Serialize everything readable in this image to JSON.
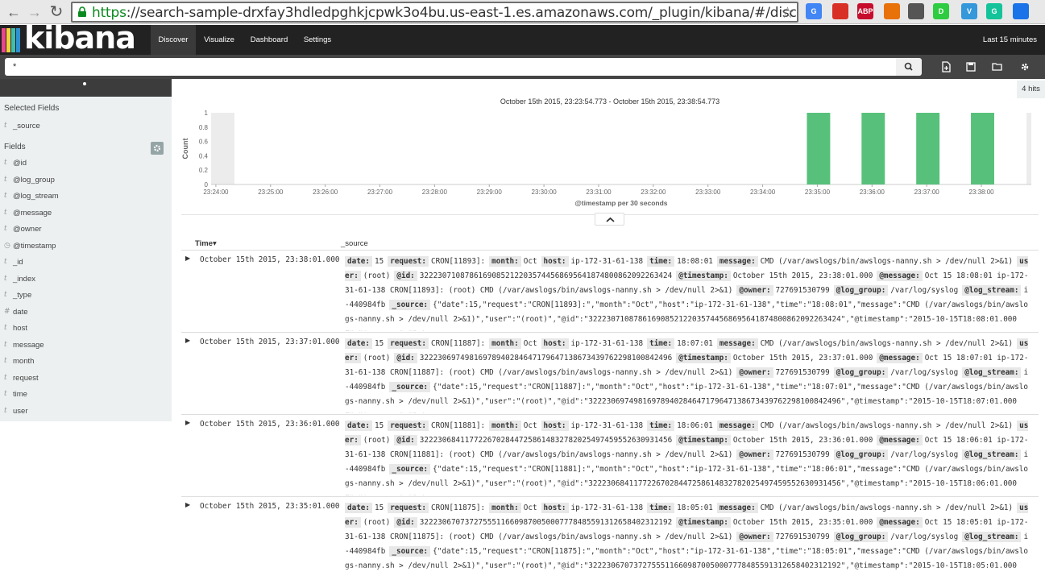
{
  "browser": {
    "url_scheme": "https",
    "url_rest": "://search-sample-drxfay3hdledpghkjcpwk3o4bu.us-east-1.es.amazonaws.com/_plugin/kibana/#/discover?_g=()&_a=",
    "extensions": [
      {
        "name": "translate-icon",
        "color": "#4285f4",
        "label": "G"
      },
      {
        "name": "red-book-icon",
        "color": "#d93025",
        "label": ""
      },
      {
        "name": "adblock-icon",
        "color": "#c70d2c",
        "label": "ABP"
      },
      {
        "name": "fire-icon",
        "color": "#e8710a",
        "label": ""
      },
      {
        "name": "mask-icon",
        "color": "#555555",
        "label": ""
      },
      {
        "name": "d-icon",
        "color": "#2ecc40",
        "label": "D"
      },
      {
        "name": "v-icon",
        "color": "#3498db",
        "label": "V"
      },
      {
        "name": "grammarly-icon",
        "color": "#15c39a",
        "label": "G"
      },
      {
        "name": "sync-icon",
        "color": "#1a73e8",
        "label": ""
      }
    ]
  },
  "nav": {
    "logo": "kibana",
    "tabs": {
      "discover": "Discover",
      "visualize": "Visualize",
      "dashboard": "Dashboard",
      "settings": "Settings"
    },
    "time_range": "Last 15 minutes"
  },
  "search": {
    "value": "*"
  },
  "sidebar": {
    "selected_heading": "Selected Fields",
    "selected_fields": [
      {
        "type": "t",
        "name": "_source"
      }
    ],
    "fields_heading": "Fields",
    "fields": [
      {
        "type": "t",
        "name": "@id"
      },
      {
        "type": "t",
        "name": "@log_group"
      },
      {
        "type": "t",
        "name": "@log_stream"
      },
      {
        "type": "t",
        "name": "@message"
      },
      {
        "type": "t",
        "name": "@owner"
      },
      {
        "type": "◷",
        "name": "@timestamp"
      },
      {
        "type": "t",
        "name": "_id"
      },
      {
        "type": "t",
        "name": "_index"
      },
      {
        "type": "t",
        "name": "_type"
      },
      {
        "type": "#",
        "name": "date"
      },
      {
        "type": "t",
        "name": "host"
      },
      {
        "type": "t",
        "name": "message"
      },
      {
        "type": "t",
        "name": "month"
      },
      {
        "type": "t",
        "name": "request"
      },
      {
        "type": "t",
        "name": "time"
      },
      {
        "type": "t",
        "name": "user"
      }
    ]
  },
  "hits": "4 hits",
  "chart_data": {
    "type": "bar",
    "title": "October 15th 2015, 23:23:54.773 - October 15th 2015, 23:38:54.773",
    "xlabel": "@timestamp per 30 seconds",
    "ylabel": "Count",
    "ylim": [
      0,
      1
    ],
    "yticks": [
      "0",
      "0.2",
      "0.4",
      "0.6",
      "0.8",
      "1"
    ],
    "xticks": [
      "23:24:00",
      "23:25:00",
      "23:26:00",
      "23:27:00",
      "23:28:00",
      "23:29:00",
      "23:30:00",
      "23:31:00",
      "23:32:00",
      "23:33:00",
      "23:34:00",
      "23:35:00",
      "23:36:00",
      "23:37:00",
      "23:38:00"
    ],
    "categories": [
      "23:35:00",
      "23:36:00",
      "23:37:00",
      "23:38:00"
    ],
    "values": [
      1,
      1,
      1,
      1
    ],
    "bar_color": "#57c17b"
  },
  "table": {
    "col_time": "Time",
    "col_source": "_source",
    "rows": [
      {
        "time": "October 15th 2015, 23:38:01.000",
        "fields": [
          [
            "date:",
            "15"
          ],
          [
            "request:",
            "CRON[11893]:"
          ],
          [
            "month:",
            "Oct"
          ],
          [
            "host:",
            "ip-172-31-61-138"
          ],
          [
            "time:",
            "18:08:01"
          ],
          [
            "message:",
            "CMD (/var/awslogs/bin/awslogs-nanny.sh > /dev/null 2>&1)"
          ],
          [
            "user:",
            "(root)"
          ],
          [
            "@id:",
            "32223071087861690852122035744568695641874800862092263424"
          ],
          [
            "@timestamp:",
            "October 15th 2015, 23:38:01.000"
          ],
          [
            "@message:",
            "Oct 15 18:08:01 ip-172-31-61-138 CRON[11893]: (root) CMD (/var/awslogs/bin/awslogs-nanny.sh > /dev/null 2>&1)"
          ],
          [
            "@owner:",
            "727691530799"
          ],
          [
            "@log_group:",
            "/var/log/syslog"
          ],
          [
            "@log_stream:",
            "i-440984fb"
          ]
        ],
        "source": "{\"date\":15,\"request\":\"CRON[11893]:\",\"month\":\"Oct\",\"host\":\"ip-172-31-61-138\",\"time\":\"18:08:01\",\"message\":\"CMD (/var/awslogs/bin/awslogs-nanny.sh > /dev/null 2>&1)\",\"user\":\"(root)\",\"@id\":\"32223071087861690852122035744568695641874800862092263424\",\"@timestamp\":\"2015-10-15T18:08:01.000Z\",\"@message\":\"Oct"
      },
      {
        "time": "October 15th 2015, 23:37:01.000",
        "fields": [
          [
            "date:",
            "15"
          ],
          [
            "request:",
            "CRON[11887]:"
          ],
          [
            "month:",
            "Oct"
          ],
          [
            "host:",
            "ip-172-31-61-138"
          ],
          [
            "time:",
            "18:07:01"
          ],
          [
            "message:",
            "CMD (/var/awslogs/bin/awslogs-nanny.sh > /dev/null 2>&1)"
          ],
          [
            "user:",
            "(root)"
          ],
          [
            "@id:",
            "32223069749816978940284647179647138673439762298100842496"
          ],
          [
            "@timestamp:",
            "October 15th 2015, 23:37:01.000"
          ],
          [
            "@message:",
            "Oct 15 18:07:01 ip-172-31-61-138 CRON[11887]: (root) CMD (/var/awslogs/bin/awslogs-nanny.sh > /dev/null 2>&1)"
          ],
          [
            "@owner:",
            "727691530799"
          ],
          [
            "@log_group:",
            "/var/log/syslog"
          ],
          [
            "@log_stream:",
            "i-440984fb"
          ]
        ],
        "source": "{\"date\":15,\"request\":\"CRON[11887]:\",\"month\":\"Oct\",\"host\":\"ip-172-31-61-138\",\"time\":\"18:07:01\",\"message\":\"CMD (/var/awslogs/bin/awslogs-nanny.sh > /dev/null 2>&1)\",\"user\":\"(root)\",\"@id\":\"32223069749816978940284647179647138673439762298100842496\",\"@timestamp\":\"2015-10-15T18:07:01.000Z\",\"@message\":\"Oct"
      },
      {
        "time": "October 15th 2015, 23:36:01.000",
        "fields": [
          [
            "date:",
            "15"
          ],
          [
            "request:",
            "CRON[11881]:"
          ],
          [
            "month:",
            "Oct"
          ],
          [
            "host:",
            "ip-172-31-61-138"
          ],
          [
            "time:",
            "18:06:01"
          ],
          [
            "message:",
            "CMD (/var/awslogs/bin/awslogs-nanny.sh > /dev/null 2>&1)"
          ],
          [
            "user:",
            "(root)"
          ],
          [
            "@id:",
            "32223068411772267028447258614832782025497459552630931456"
          ],
          [
            "@timestamp:",
            "October 15th 2015, 23:36:01.000"
          ],
          [
            "@message:",
            "Oct 15 18:06:01 ip-172-31-61-138 CRON[11881]: (root) CMD (/var/awslogs/bin/awslogs-nanny.sh > /dev/null 2>&1)"
          ],
          [
            "@owner:",
            "727691530799"
          ],
          [
            "@log_group:",
            "/var/log/syslog"
          ],
          [
            "@log_stream:",
            "i-440984fb"
          ]
        ],
        "source": "{\"date\":15,\"request\":\"CRON[11881]:\",\"month\":\"Oct\",\"host\":\"ip-172-31-61-138\",\"time\":\"18:06:01\",\"message\":\"CMD (/var/awslogs/bin/awslogs-nanny.sh > /dev/null 2>&1)\",\"user\":\"(root)\",\"@id\":\"32223068411772267028447258614832782025497459552630931456\",\"@timestamp\":\"2015-10-15T18:06:01.000Z\",\"@message\":\"Oct"
      },
      {
        "time": "October 15th 2015, 23:35:01.000",
        "fields": [
          [
            "date:",
            "15"
          ],
          [
            "request:",
            "CRON[11875]:"
          ],
          [
            "month:",
            "Oct"
          ],
          [
            "host:",
            "ip-172-31-61-138"
          ],
          [
            "time:",
            "18:05:01"
          ],
          [
            "message:",
            "CMD (/var/awslogs/bin/awslogs-nanny.sh > /dev/null 2>&1)"
          ],
          [
            "user:",
            "(root)"
          ],
          [
            "@id:",
            "32223067073727555116609870050007778485591312658402312192"
          ],
          [
            "@timestamp:",
            "October 15th 2015, 23:35:01.000"
          ],
          [
            "@message:",
            "Oct 15 18:05:01 ip-172-31-61-138 CRON[11875]: (root) CMD (/var/awslogs/bin/awslogs-nanny.sh > /dev/null 2>&1)"
          ],
          [
            "@owner:",
            "727691530799"
          ],
          [
            "@log_group:",
            "/var/log/syslog"
          ],
          [
            "@log_stream:",
            "i-440984fb"
          ]
        ],
        "source": "{\"date\":15,\"request\":\"CRON[11875]:\",\"month\":\"Oct\",\"host\":\"ip-172-31-61-138\",\"time\":\"18:05:01\",\"message\":\"CMD (/var/awslogs/bin/awslogs-nanny.sh > /dev/null 2>&1)\",\"user\":\"(root)\",\"@id\":\"32223067073727555116609870050007778485591312658402312192\",\"@timestamp\":\"2015-10-15T18:05:01.000Z\",\"@message\":\"Oct"
      }
    ]
  }
}
